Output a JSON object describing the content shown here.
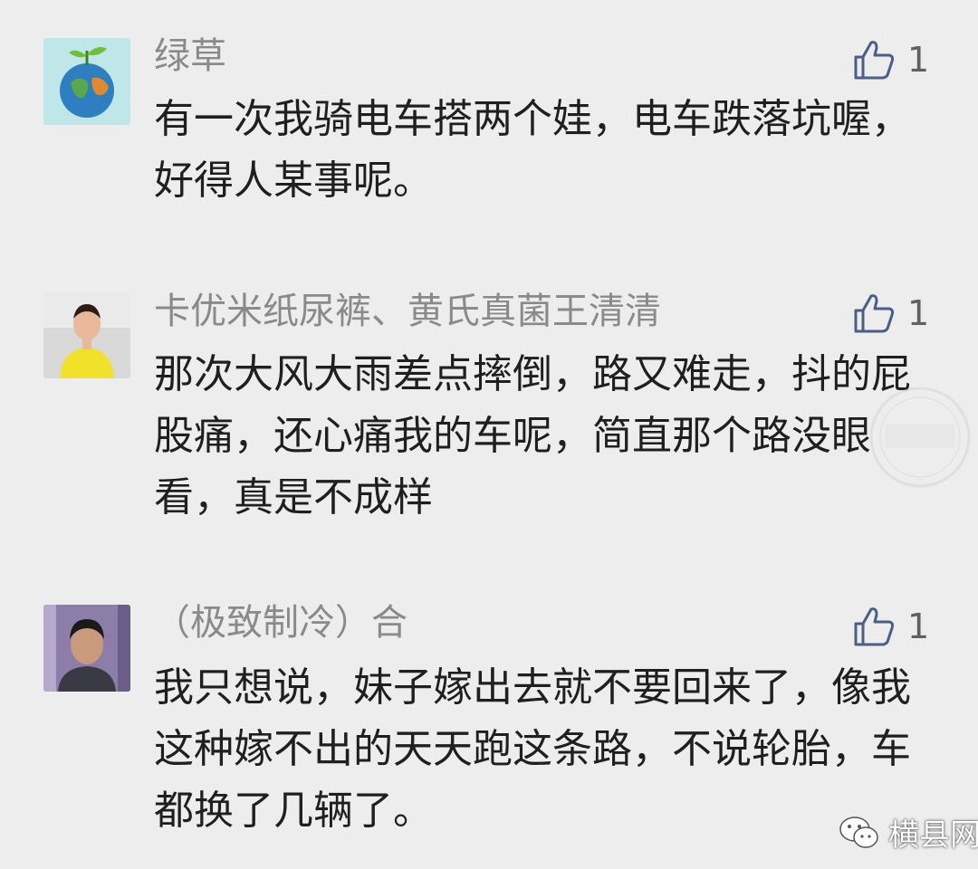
{
  "comments": [
    {
      "nickname": "绿草",
      "likes": "1",
      "text": "有一次我骑电车搭两个娃，电车跌落坑喔，好得人某事呢。",
      "avatar": "earth-plant-avatar"
    },
    {
      "nickname": "卡优米纸尿裤、黄氏真菌王清清",
      "likes": "1",
      "text": "那次大风大雨差点摔倒，路又难走，抖的屁股痛，还心痛我的车呢，简直那个路没眼看，真是不成样",
      "avatar": "woman-yellow-shirt-avatar"
    },
    {
      "nickname": "（极致制冷）合",
      "likes": "1",
      "text": "我只想说，妹子嫁出去就不要回来了，像我这种嫁不出的天天跑这条路，不说轮胎，车都换了几辆了。",
      "avatar": "man-portrait-avatar"
    }
  ],
  "watermark": {
    "brand": "横县网",
    "icon": "wechat-icon"
  },
  "colors": {
    "background": "#ededed",
    "nickname": "#8a8a8a",
    "text": "#1f1f1f",
    "like_icon": "#4a5f86"
  }
}
